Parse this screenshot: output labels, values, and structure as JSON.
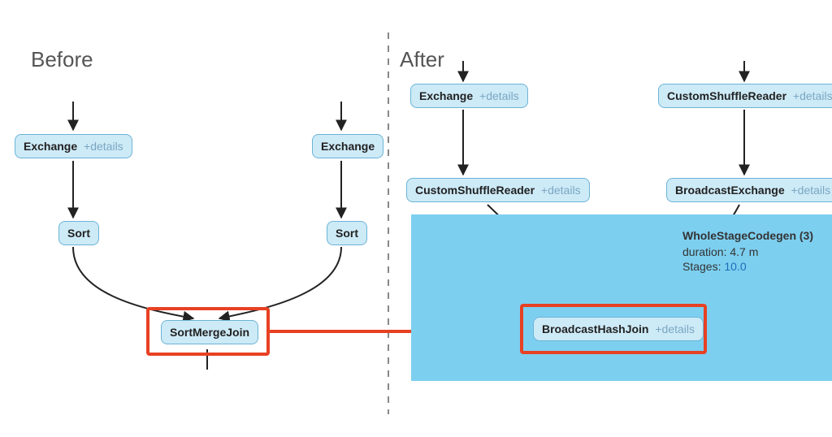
{
  "headings": {
    "before": "Before",
    "after": "After"
  },
  "before": {
    "exchange_left": {
      "title": "Exchange",
      "details": "+details"
    },
    "exchange_right": {
      "title": "Exchange"
    },
    "sort_left": {
      "title": "Sort"
    },
    "sort_right": {
      "title": "Sort"
    },
    "join": {
      "title": "SortMergeJoin"
    }
  },
  "after": {
    "exchange": {
      "title": "Exchange",
      "details": "+details"
    },
    "custom_shuffle_reader_top": {
      "title": "CustomShuffleReader",
      "details": "+details"
    },
    "custom_shuffle_reader_left": {
      "title": "CustomShuffleReader",
      "details": "+details"
    },
    "broadcast_exchange": {
      "title": "BroadcastExchange",
      "details": "+details"
    },
    "join": {
      "title": "BroadcastHashJoin",
      "details": "+details"
    },
    "stage": {
      "title": "WholeStageCodegen (3)",
      "duration_label": "duration:",
      "duration_value": "4.7 m",
      "stages_label": "Stages:",
      "stages_value": "10.0"
    }
  },
  "colors": {
    "node_fill": "#cdeaf7",
    "node_border": "#6bb4d6",
    "stage_fill": "#7dcff0",
    "highlight": "#e74123",
    "edge": "#222222",
    "details_text": "#7aa7c2",
    "heading_text": "#555555"
  }
}
